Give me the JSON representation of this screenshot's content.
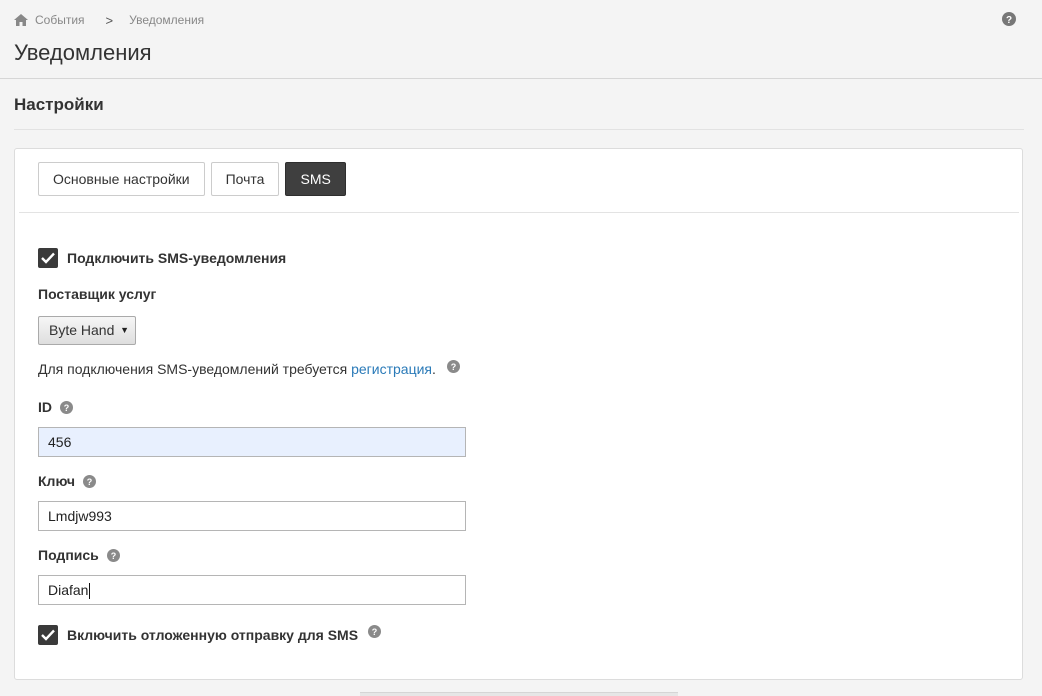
{
  "breadcrumb": {
    "items": [
      "События",
      "Уведомления"
    ],
    "separator": ">"
  },
  "page_title": "Уведомления",
  "section_title": "Настройки",
  "tabs": [
    {
      "label": "Основные настройки",
      "active": false
    },
    {
      "label": "Почта",
      "active": false
    },
    {
      "label": "SMS",
      "active": true
    }
  ],
  "sms": {
    "enable_label": "Подключить SMS-уведомления",
    "enable_checked": true,
    "provider_label": "Поставщик услуг",
    "provider_value": "Byte Hand",
    "info_text": "Для подключения SMS-уведомлений требуется ",
    "info_link": "регистрация",
    "info_suffix": ".",
    "id_label": "ID",
    "id_value": "456",
    "key_label": "Ключ",
    "key_value": "Lmdjw993",
    "signature_label": "Подпись",
    "signature_value": "Diafan",
    "delayed_label": "Включить отложенную отправку для SMS",
    "delayed_checked": true
  },
  "colors": {
    "active_tab": "#3f3f3f",
    "link": "#2a7ab8",
    "autofill_bg": "#e8f0fe",
    "checkbox": "#3a3a3a"
  },
  "icons": [
    "home-icon",
    "help-icon",
    "check-icon"
  ]
}
